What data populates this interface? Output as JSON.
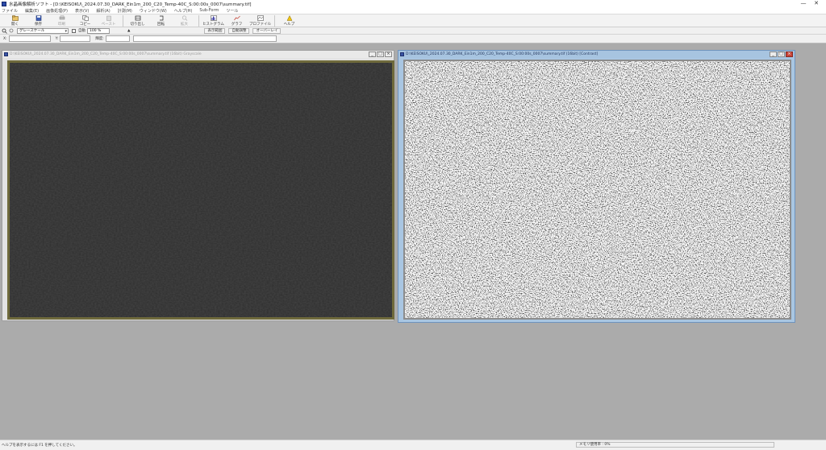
{
  "window": {
    "title": "水晶画像解析ソフト - [D:\\KEISOKU\\_2024.07.30_DARK_Ein1m_200_C20_Temp-40C_S:00:00s_0007\\summary.tif]",
    "controls": [
      "—",
      "✕"
    ]
  },
  "menu": [
    "ファイル",
    "編集(E)",
    "画像処理(P)",
    "表示(V)",
    "解析(A)",
    "計測(M)",
    "ウィンドウ(W)",
    "ヘルプ(H)",
    "Sub-Form",
    "ツール"
  ],
  "toolbar": {
    "buttons": [
      {
        "label": "開く",
        "icon": "open-file-icon",
        "enabled": true
      },
      {
        "label": "保存",
        "icon": "save-icon",
        "enabled": true
      },
      {
        "label": "印刷",
        "icon": "print-icon",
        "enabled": false
      },
      {
        "label": "コピー",
        "icon": "copy-icon",
        "enabled": true
      },
      {
        "label": "ペースト",
        "icon": "paste-icon",
        "enabled": false
      },
      {
        "label": "切り出し",
        "icon": "crop-icon",
        "enabled": true
      },
      {
        "label": "回転",
        "icon": "rotate-icon",
        "enabled": true
      },
      {
        "label": "拡大",
        "icon": "zoom-icon",
        "enabled": false
      },
      {
        "label": "ヒストグラム",
        "icon": "histogram-icon",
        "enabled": true
      },
      {
        "label": "グラフ",
        "icon": "graph-icon",
        "enabled": true
      },
      {
        "label": "プロファイル",
        "icon": "profile-icon",
        "enabled": true
      },
      {
        "label": "ヘルプ",
        "icon": "help-icon",
        "enabled": true
      }
    ]
  },
  "toolbar2": {
    "color_mode": "グレースケール",
    "checkbox_label": "自動",
    "zoom_value": "100 %",
    "btn1": "表示範囲",
    "btn2": "自動調整",
    "btn3": "オーバーレイ"
  },
  "toolbar3": {
    "label1": "X:",
    "label2": "Y:",
    "label3": "輝度:",
    "value1": "",
    "value2": "",
    "value3": ""
  },
  "child_left": {
    "title": "D:\\KEISOKU\\_2024.07.30_DARK_Ein1m_200_C20_Temp-40C_S:00:00s_0007\\summary.tif (16bit) Grayscale",
    "controls": [
      "_",
      "□",
      "×"
    ]
  },
  "child_right": {
    "title": "D:\\KEISOKU\\_2024.07.30_DARK_Ein1m_200_C20_Temp-40C_S:00:00s_0007\\summary.tif (16bit) [Contrast]",
    "controls": [
      "_",
      "□",
      "×"
    ]
  },
  "status": {
    "left": "ヘルプを表示するには F1 を押してください。",
    "right": "メモリ使用率 : 0%"
  }
}
